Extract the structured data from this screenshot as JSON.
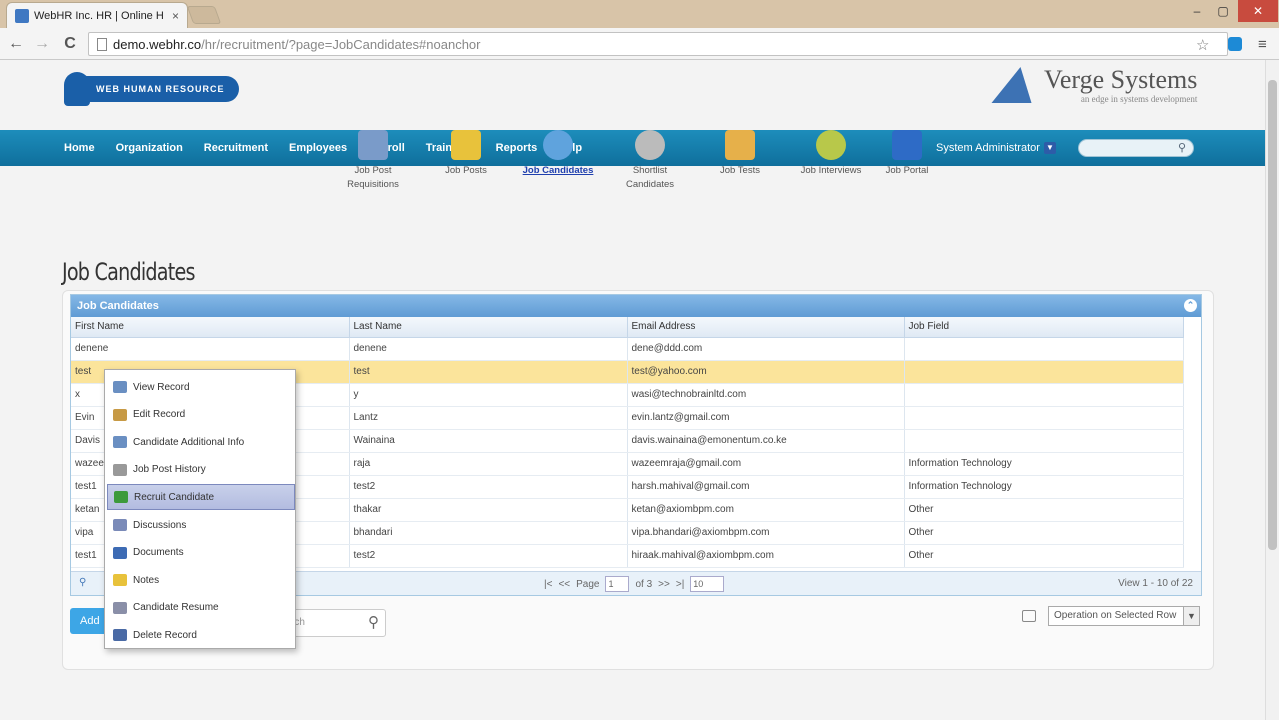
{
  "browser": {
    "tab_title": "WebHR Inc. HR | Online H",
    "tab_close": "×",
    "url_host": "demo.webhr.co",
    "url_path": "/hr/recruitment/?page=JobCandidates#noanchor",
    "win_min": "–",
    "win_max": "▢",
    "win_close": "✕",
    "back": "←",
    "forward": "→",
    "reload": "C",
    "star": "☆",
    "menu": "≡"
  },
  "header": {
    "logo_text": "WEB HUMAN RESOURCE",
    "brand_name": "Verge Systems",
    "brand_tagline": "an edge in systems development"
  },
  "nav": {
    "items": [
      "Home",
      "Organization",
      "Recruitment",
      "Employees",
      "Payroll",
      "Trainings",
      "Reports",
      "Help"
    ],
    "user": "System Administrator"
  },
  "module_icons": [
    {
      "label": "Job Post Requisitions",
      "icon": "id-card-icon",
      "color": "#7a9bc9"
    },
    {
      "label": "Job Posts",
      "icon": "folder-icon",
      "color": "#e8c23b"
    },
    {
      "label": "Job Candidates",
      "icon": "people-icon",
      "color": "#5fa3dd"
    },
    {
      "label": "Shortlist Candidates",
      "icon": "magnifier-icon",
      "color": "#bbbbbb"
    },
    {
      "label": "Job Tests",
      "icon": "tools-icon",
      "color": "#e6b04a"
    },
    {
      "label": "Job Interviews",
      "icon": "chat-icon",
      "color": "#b8c84a"
    },
    {
      "label": "Job Portal",
      "icon": "globe-icon",
      "color": "#2e6bc6"
    }
  ],
  "page_title": "Job Candidates",
  "grid": {
    "caption": "Job Candidates",
    "columns": [
      "First Name",
      "Last Name",
      "Email Address",
      "Job Field"
    ],
    "rows": [
      [
        "denene",
        "denene",
        "dene@ddd.com",
        ""
      ],
      [
        "test",
        "test",
        "test@yahoo.com",
        ""
      ],
      [
        "x",
        "y",
        "wasi@technobrainltd.com",
        ""
      ],
      [
        "Evin",
        "Lantz",
        "evin.lantz@gmail.com",
        ""
      ],
      [
        "Davis",
        "Wainaina",
        "davis.wainaina@emonentum.co.ke",
        ""
      ],
      [
        "wazee",
        "raja",
        "wazeemraja@gmail.com",
        "Information Technology"
      ],
      [
        "test1",
        "test2",
        "harsh.mahival@gmail.com",
        "Information Technology"
      ],
      [
        "ketan",
        "thakar",
        "ketan@axiombpm.com",
        "Other"
      ],
      [
        "vipa",
        "bhandari",
        "vipa.bhandari@axiombpm.com",
        "Other"
      ],
      [
        "test1",
        "test2",
        "hiraak.mahival@axiombpm.com",
        "Other"
      ]
    ],
    "pager": {
      "page_label": "Page",
      "page_value": "1",
      "of_label": "of 3",
      "rows_value": "10",
      "view_text": "View 1 - 10 of 22"
    }
  },
  "bottom": {
    "add_label": "Add",
    "search_placeholder": "rch",
    "operation_select": "Operation on Selected Row"
  },
  "context_menu": [
    {
      "label": "View Record",
      "icon": "view-record-icon",
      "color": "#6a8fc2"
    },
    {
      "label": "Edit Record",
      "icon": "edit-record-icon",
      "color": "#c79a45"
    },
    {
      "label": "Candidate Additional Info",
      "icon": "info-icon",
      "color": "#6a8fc2"
    },
    {
      "label": "Job Post History",
      "icon": "history-icon",
      "color": "#999999"
    },
    {
      "label": "Recruit Candidate",
      "icon": "check-icon",
      "color": "#3c9a3c"
    },
    {
      "label": "Discussions",
      "icon": "discussion-icon",
      "color": "#7a8ab8"
    },
    {
      "label": "Documents",
      "icon": "documents-icon",
      "color": "#3d6bb4"
    },
    {
      "label": "Notes",
      "icon": "notes-icon",
      "color": "#e8c23b"
    },
    {
      "label": "Candidate Resume",
      "icon": "resume-icon",
      "color": "#8a8fa8"
    },
    {
      "label": "Delete Record",
      "icon": "trash-icon",
      "color": "#4a6aa5"
    }
  ]
}
